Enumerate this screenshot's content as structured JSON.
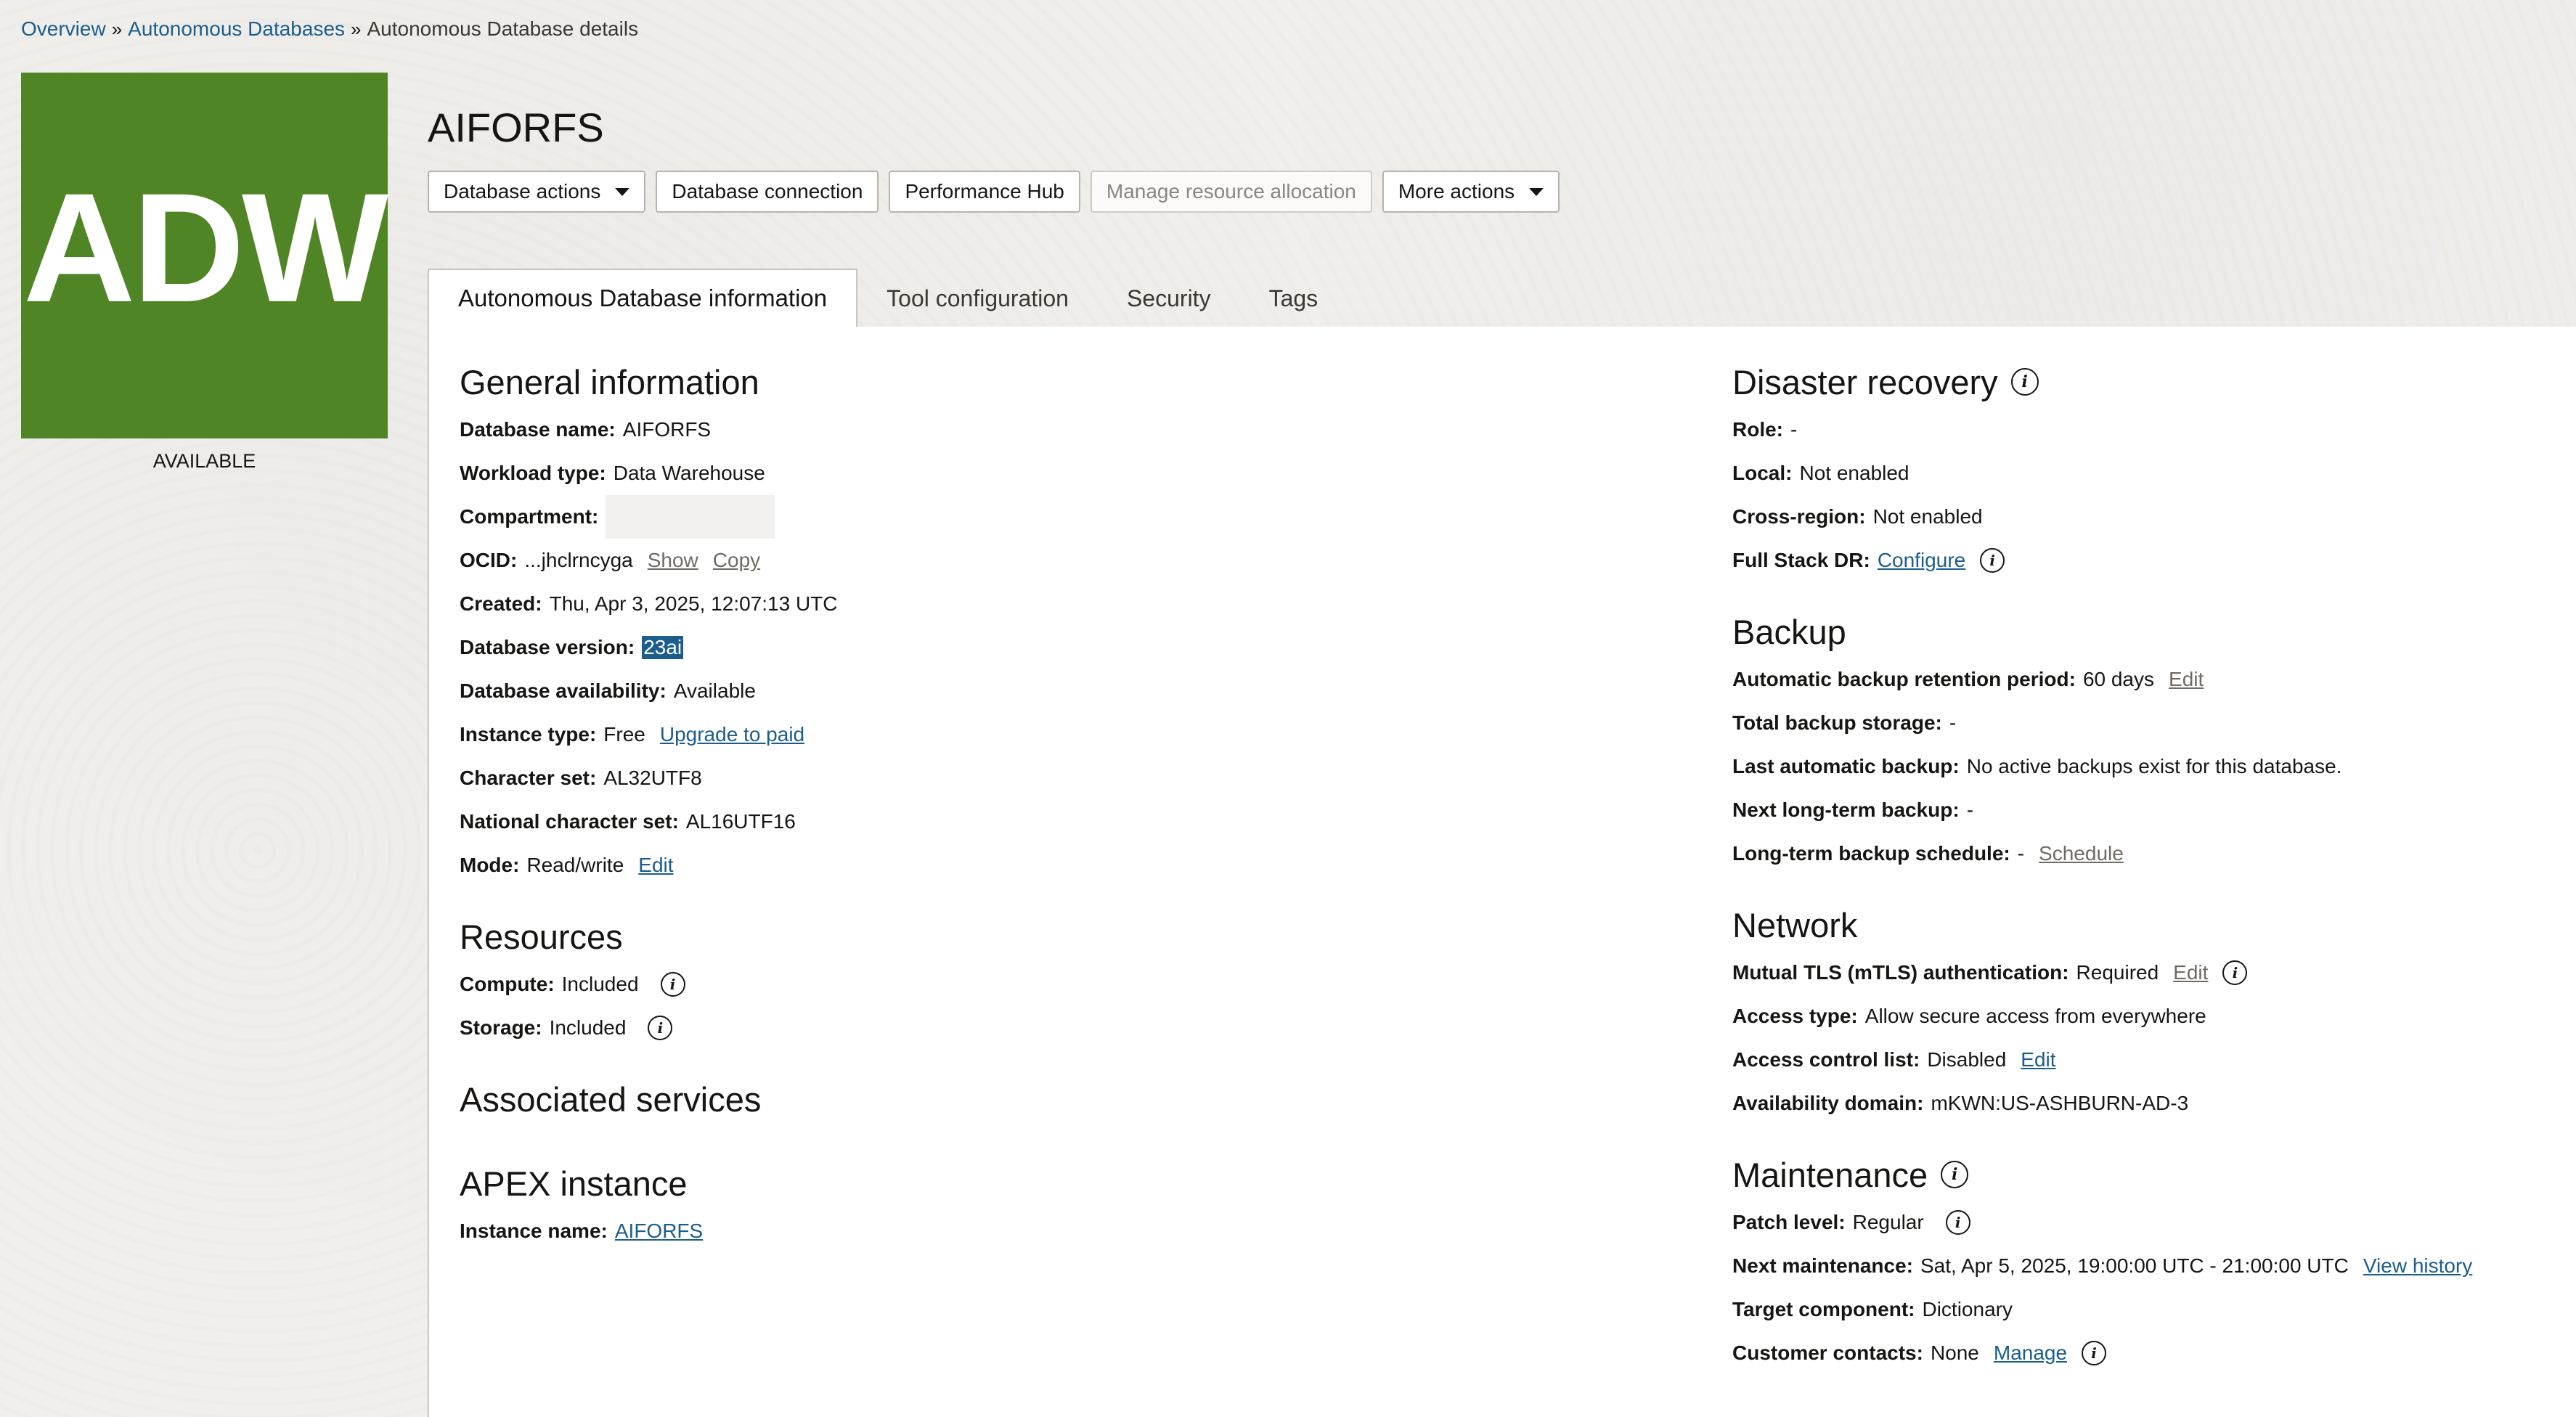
{
  "breadcrumb": {
    "items": [
      "Overview",
      "Autonomous Databases"
    ],
    "current": "Autonomous Database details",
    "separator": "»"
  },
  "logo": {
    "text": "ADW",
    "color": "#4f8524"
  },
  "lifecycle_state": "AVAILABLE",
  "title": "AIFORFS",
  "actions": {
    "database_actions": "Database actions",
    "database_connection": "Database connection",
    "performance_hub": "Performance Hub",
    "manage_resource_allocation": "Manage resource allocation",
    "more_actions": "More actions"
  },
  "tabs": [
    "Autonomous Database information",
    "Tool configuration",
    "Security",
    "Tags"
  ],
  "general": {
    "title": "General information",
    "database_name": {
      "label": "Database name:",
      "value": "AIFORFS"
    },
    "workload_type": {
      "label": "Workload type:",
      "value": "Data Warehouse"
    },
    "compartment": {
      "label": "Compartment:"
    },
    "ocid": {
      "label": "OCID:",
      "value": "...jhclrncyga",
      "show": "Show",
      "copy": "Copy"
    },
    "created": {
      "label": "Created:",
      "value": "Thu, Apr 3, 2025, 12:07:13 UTC"
    },
    "database_version": {
      "label": "Database version:",
      "value": "23ai"
    },
    "database_availability": {
      "label": "Database availability:",
      "value": "Available"
    },
    "instance_type": {
      "label": "Instance type:",
      "value": "Free",
      "action": "Upgrade to paid"
    },
    "character_set": {
      "label": "Character set:",
      "value": "AL32UTF8"
    },
    "national_character_set": {
      "label": "National character set:",
      "value": "AL16UTF16"
    },
    "mode": {
      "label": "Mode:",
      "value": "Read/write",
      "action": "Edit"
    }
  },
  "resources": {
    "title": "Resources",
    "compute": {
      "label": "Compute:",
      "value": "Included"
    },
    "storage": {
      "label": "Storage:",
      "value": "Included"
    }
  },
  "associated_services": {
    "title": "Associated services"
  },
  "apex": {
    "title": "APEX instance",
    "instance_name": {
      "label": "Instance name:",
      "value": "AIFORFS"
    }
  },
  "disaster_recovery": {
    "title": "Disaster recovery",
    "role": {
      "label": "Role:",
      "value": "-"
    },
    "local": {
      "label": "Local:",
      "value": "Not enabled"
    },
    "cross_region": {
      "label": "Cross-region:",
      "value": "Not enabled"
    },
    "full_stack_dr": {
      "label": "Full Stack DR:",
      "action": "Configure"
    }
  },
  "backup": {
    "title": "Backup",
    "retention": {
      "label": "Automatic backup retention period:",
      "value": "60 days",
      "action": "Edit"
    },
    "total_storage": {
      "label": "Total backup storage:",
      "value": "-"
    },
    "last_auto": {
      "label": "Last automatic backup:",
      "value": "No active backups exist for this database."
    },
    "next_long_term": {
      "label": "Next long-term backup:",
      "value": "-"
    },
    "long_term_schedule": {
      "label": "Long-term backup schedule:",
      "value": "-",
      "action": "Schedule"
    }
  },
  "network": {
    "title": "Network",
    "mtls": {
      "label": "Mutual TLS (mTLS) authentication:",
      "value": "Required",
      "action": "Edit"
    },
    "access_type": {
      "label": "Access type:",
      "value": "Allow secure access from everywhere"
    },
    "acl": {
      "label": "Access control list:",
      "value": "Disabled",
      "action": "Edit"
    },
    "availability_domain": {
      "label": "Availability domain:",
      "value": "mKWN:US-ASHBURN-AD-3"
    }
  },
  "maintenance": {
    "title": "Maintenance",
    "patch_level": {
      "label": "Patch level:",
      "value": "Regular"
    },
    "next_maintenance": {
      "label": "Next maintenance:",
      "value": "Sat, Apr 5, 2025, 19:00:00 UTC - 21:00:00 UTC",
      "action": "View history"
    },
    "target_component": {
      "label": "Target component:",
      "value": "Dictionary"
    },
    "customer_contacts": {
      "label": "Customer contacts:",
      "value": "None",
      "action": "Manage"
    }
  },
  "icons": {
    "info": "info-icon",
    "caret": "caret-down-icon"
  },
  "colors": {
    "link": "#1b5d8c",
    "brand_tile": "#4f8524",
    "selection": "#1b5d8c"
  }
}
